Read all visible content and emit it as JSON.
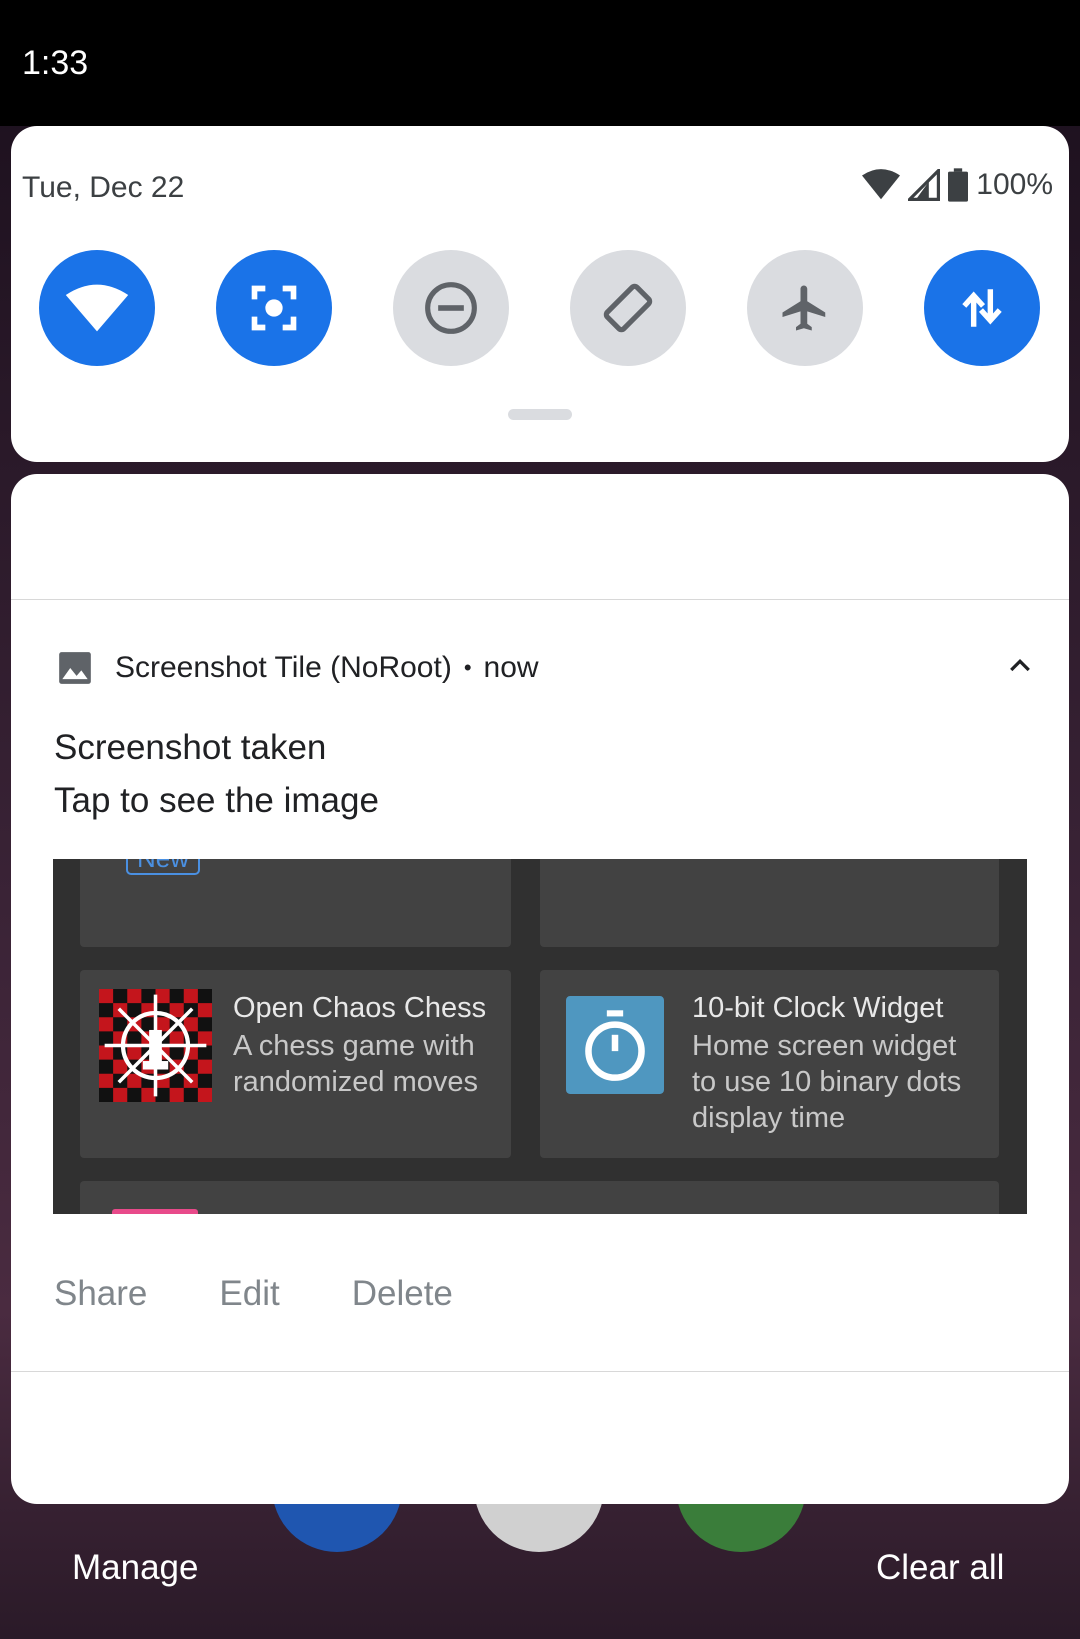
{
  "status_bar": {
    "time": "1:33"
  },
  "quick_settings": {
    "date": "Tue, Dec 22",
    "battery": "100%",
    "tiles": [
      {
        "name": "wifi",
        "active": true
      },
      {
        "name": "screenshot",
        "active": true
      },
      {
        "name": "do-not-disturb",
        "active": false
      },
      {
        "name": "auto-rotate",
        "active": false
      },
      {
        "name": "airplane-mode",
        "active": false
      },
      {
        "name": "mobile-data",
        "active": true
      }
    ]
  },
  "notification": {
    "app_name": "Screenshot Tile (NoRoot)",
    "separator": "•",
    "time": "now",
    "title": "Screenshot taken",
    "text": "Tap to see the image",
    "preview": {
      "badge": "New",
      "card1": {
        "title": "Open Chaos Chess",
        "desc": "A chess game with randomized moves"
      },
      "card2": {
        "title": "10-bit Clock Widget",
        "desc": "Home screen widget to use 10 binary dots display time"
      }
    },
    "actions": {
      "share": "Share",
      "edit": "Edit",
      "delete": "Delete"
    }
  },
  "footer": {
    "manage": "Manage",
    "clear_all": "Clear all"
  },
  "colors": {
    "accent": "#1a73e8",
    "tile_off": "#dadce0"
  }
}
